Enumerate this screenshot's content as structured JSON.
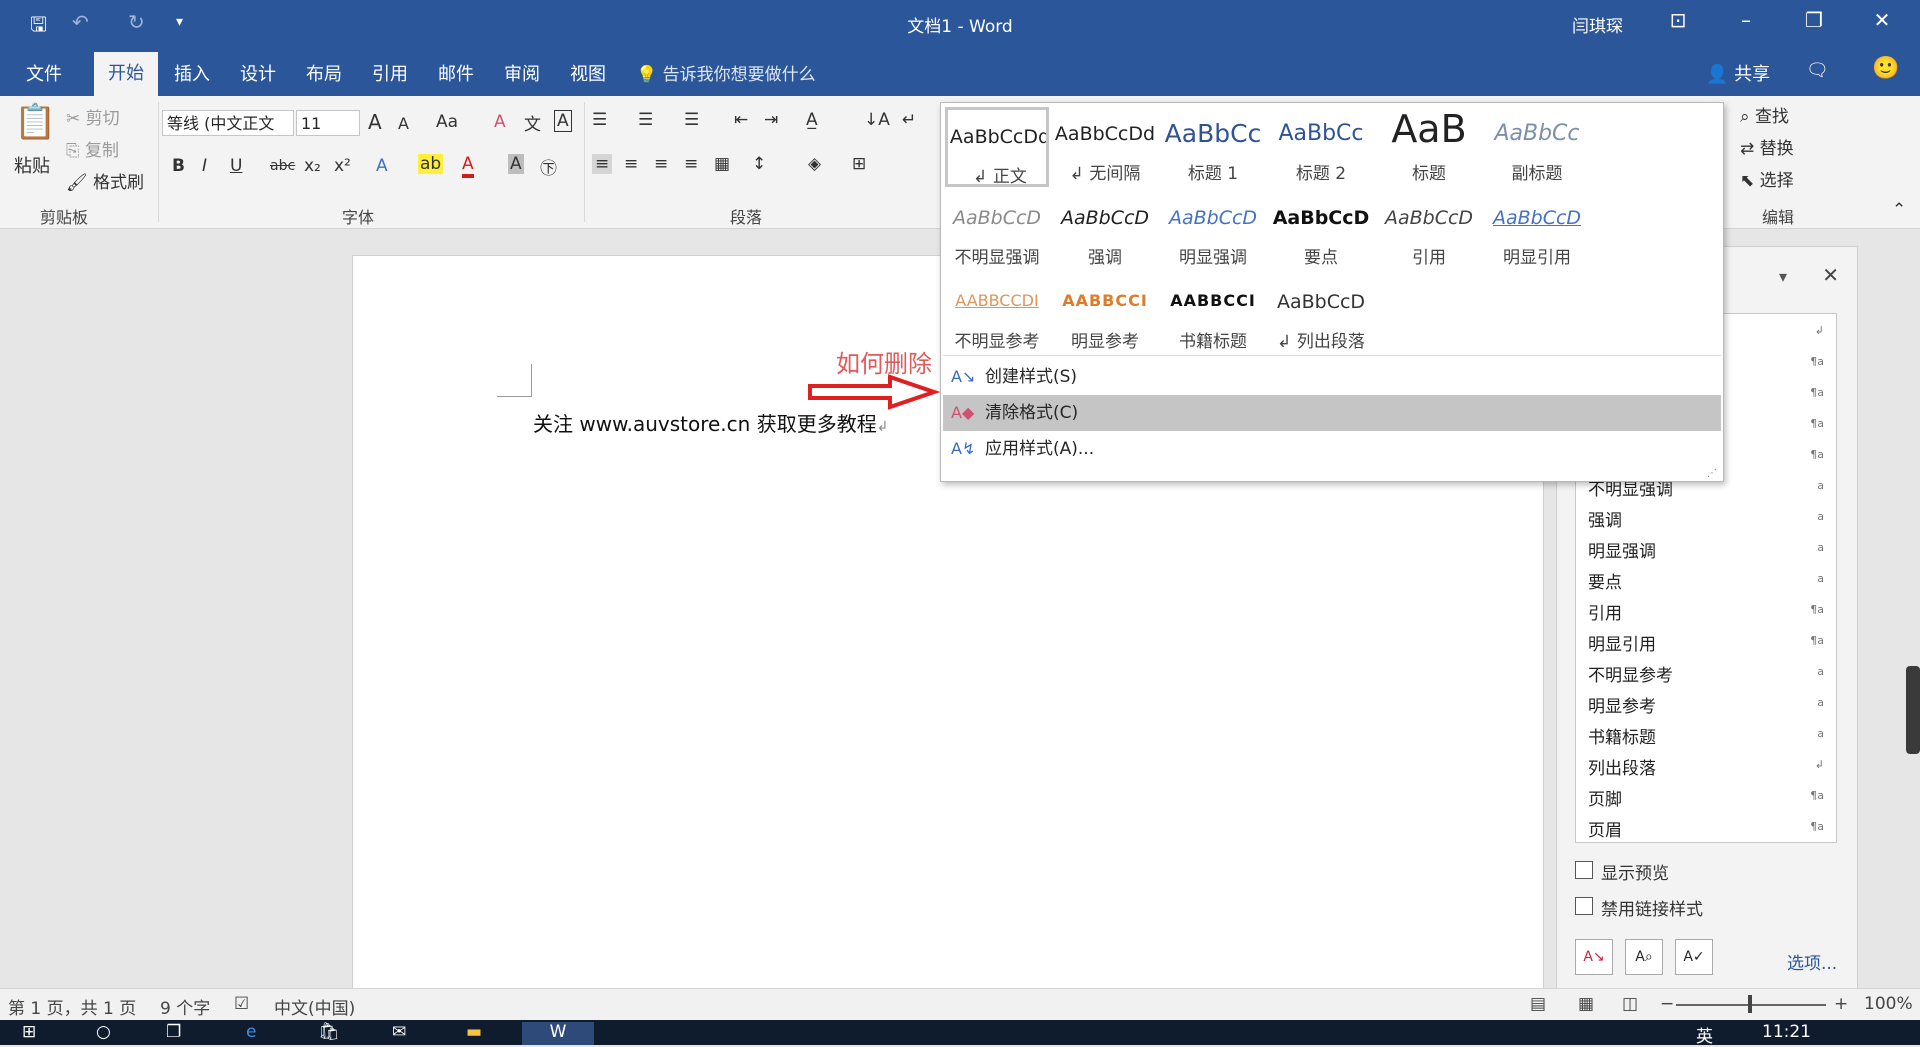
{
  "window": {
    "title": "文档1  -  Word",
    "user": "闫琪琛"
  },
  "titlebar_icons": {
    "save": "save-icon",
    "undo": "undo-icon",
    "redo": "redo-icon",
    "customize": "customize-icon",
    "ribbon_display": "ribbon-display-icon",
    "minimize": "minimize-icon",
    "restore": "restore-icon",
    "close": "close-icon"
  },
  "tabs": [
    {
      "label": "文件"
    },
    {
      "label": "开始"
    },
    {
      "label": "插入"
    },
    {
      "label": "设计"
    },
    {
      "label": "布局"
    },
    {
      "label": "引用"
    },
    {
      "label": "邮件"
    },
    {
      "label": "审阅"
    },
    {
      "label": "视图"
    }
  ],
  "tellme": "告诉我你想要做什么",
  "share": "共享",
  "ribbon": {
    "clipboard": {
      "paste": "粘贴",
      "cut": "剪切",
      "copy": "复制",
      "format_painter": "格式刷",
      "label": "剪贴板"
    },
    "font": {
      "name": "等线 (中文正文",
      "size": "11",
      "label": "字体",
      "bold": "B",
      "italic": "I",
      "underline": "U",
      "strike": "abc",
      "grow": "A",
      "shrink": "A",
      "case": "Aa"
    },
    "paragraph": {
      "label": "段落"
    },
    "editing": {
      "find": "查找",
      "replace": "替换",
      "select": "选择",
      "label": "编辑"
    }
  },
  "gallery": {
    "row1": [
      {
        "sample": "AaBbCcDd",
        "label": "↲ 正文"
      },
      {
        "sample": "AaBbCcDd",
        "label": "↲ 无间隔"
      },
      {
        "sample": "AaBbCc",
        "label": "标题 1"
      },
      {
        "sample": "AaBbCc",
        "label": "标题 2"
      },
      {
        "sample": "AaB",
        "label": "标题"
      },
      {
        "sample": "AaBbCc",
        "label": "副标题"
      }
    ],
    "row2": [
      {
        "sample": "AaBbCcD",
        "label": "不明显强调"
      },
      {
        "sample": "AaBbCcD",
        "label": "强调"
      },
      {
        "sample": "AaBbCcD",
        "label": "明显强调"
      },
      {
        "sample": "AaBbCcD",
        "label": "要点"
      },
      {
        "sample": "AaBbCcD",
        "label": "引用"
      },
      {
        "sample": "AaBbCcD",
        "label": "明显引用"
      }
    ],
    "row3": [
      {
        "sample": "AABBCCDI",
        "label": "不明显参考"
      },
      {
        "sample": "AABBCCI",
        "label": "明显参考"
      },
      {
        "sample": "AABBCCI",
        "label": "书籍标题"
      },
      {
        "sample": "AaBbCcD",
        "label": "↲ 列出段落"
      }
    ],
    "menu": [
      {
        "label": "创建样式(S)"
      },
      {
        "label": "清除格式(C)"
      },
      {
        "label": "应用样式(A)..."
      }
    ]
  },
  "document": {
    "text": "关注 www.auvstore.cn 获取更多教程",
    "annotation": "如何删除"
  },
  "styles_pane": {
    "items": [
      {
        "name": "",
        "mark": "↲"
      },
      {
        "name": "",
        "mark": "¶a"
      },
      {
        "name": "",
        "mark": "¶a"
      },
      {
        "name": "",
        "mark": "¶a"
      },
      {
        "name": "",
        "mark": "¶a"
      },
      {
        "name": "不明显强调",
        "mark": "a"
      },
      {
        "name": "强调",
        "mark": "a"
      },
      {
        "name": "明显强调",
        "mark": "a"
      },
      {
        "name": "要点",
        "mark": "a"
      },
      {
        "name": "引用",
        "mark": "¶a"
      },
      {
        "name": "明显引用",
        "mark": "¶a"
      },
      {
        "name": "不明显参考",
        "mark": "a"
      },
      {
        "name": "明显参考",
        "mark": "a"
      },
      {
        "name": "书籍标题",
        "mark": "a"
      },
      {
        "name": "列出段落",
        "mark": "↲"
      },
      {
        "name": "页脚",
        "mark": "¶a"
      },
      {
        "name": "页眉",
        "mark": "¶a"
      }
    ],
    "show_preview": "显示预览",
    "disable_linked": "禁用链接样式",
    "options": "选项..."
  },
  "status": {
    "page": "第 1 页，共 1 页",
    "words": "9 个字",
    "lang": "中文(中国)",
    "zoom": "100%"
  },
  "taskbar": {
    "time": "11:21",
    "ime": "英"
  }
}
